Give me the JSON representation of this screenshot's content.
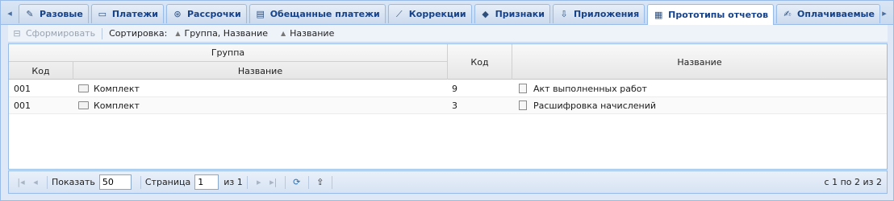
{
  "tabs": [
    {
      "label": "Разовые",
      "icon": "wrench-icon"
    },
    {
      "label": "Платежи",
      "icon": "card-icon"
    },
    {
      "label": "Рассрочки",
      "icon": "lifebuoy-icon"
    },
    {
      "label": "Обещанные платежи",
      "icon": "promise-icon"
    },
    {
      "label": "Коррекции",
      "icon": "wand-icon"
    },
    {
      "label": "Признаки",
      "icon": "tag-icon"
    },
    {
      "label": "Приложения",
      "icon": "download-doc-icon"
    },
    {
      "label": "Прототипы отчетов",
      "icon": "report-icon",
      "active": true
    },
    {
      "label": "Оплачиваемые",
      "icon": "edit-doc-icon"
    }
  ],
  "toolbar": {
    "generate_label": "Сформировать",
    "sort_label": "Сортировка:",
    "sort_items": [
      "Группа, Название",
      "Название"
    ]
  },
  "grid": {
    "header": {
      "group": "Группа",
      "group_code": "Код",
      "group_name": "Название",
      "code": "Код",
      "name": "Название"
    },
    "rows": [
      {
        "group_code": "001",
        "group_name": "Комплект",
        "code": "9",
        "name": "Акт выполненных работ"
      },
      {
        "group_code": "001",
        "group_name": "Комплект",
        "code": "3",
        "name": "Расшифровка начислений"
      }
    ]
  },
  "pager": {
    "show_label": "Показать",
    "page_size": "50",
    "page_label": "Страница",
    "page": "1",
    "of_label": "из 1",
    "status": "с 1 по 2 из 2"
  }
}
